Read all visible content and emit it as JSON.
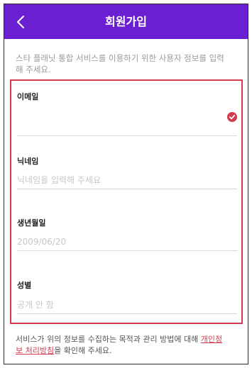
{
  "appbar": {
    "title": "회원가입",
    "back_icon": "chevron-left-icon"
  },
  "intro_text": "스타 플래닛 통합 서비스를 이용하기 위한 사용자 정보를 입력해 주세요.",
  "fields": {
    "email": {
      "label": "이메일",
      "value": "",
      "placeholder": "",
      "status_icon": "check-circle-icon"
    },
    "nickname": {
      "label": "닉네임",
      "value": "",
      "placeholder": "닉네임을 입력해 주세요"
    },
    "birthdate": {
      "label": "생년월일",
      "value": "",
      "placeholder": "2009/06/20"
    },
    "gender": {
      "label": "성별",
      "value": "",
      "placeholder": "공개 안 함"
    }
  },
  "privacy": {
    "text_before": "서비스가 위의 정보를 수집하는 목적과 관리 방법에 대해 ",
    "link_label": "개인정보 처리방침",
    "text_after": "을 확인해 주세요."
  },
  "colors": {
    "appbar": "#6a1fd0",
    "accent": "#d33b4e"
  }
}
